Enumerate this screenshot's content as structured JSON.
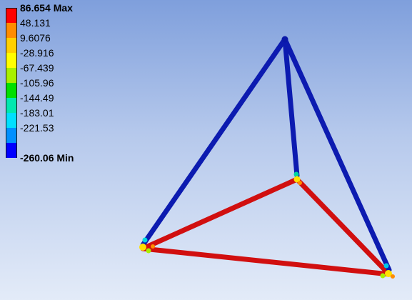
{
  "legend": {
    "max_label": "86.654 Max",
    "min_label": "-260.06 Min",
    "labels": [
      "48.131",
      "9.6076",
      "-28.916",
      "-67.439",
      "-105.96",
      "-144.49",
      "-183.01",
      "-221.53"
    ],
    "colors": [
      "#ff0000",
      "#ff8c00",
      "#ffd000",
      "#ffff00",
      "#a8f000",
      "#00e000",
      "#00e8b0",
      "#00e0ff",
      "#0090ff",
      "#0000ff"
    ]
  },
  "model": {
    "member_colors": {
      "upper_members": "#0c1bb0",
      "base_members": "#d10f0f"
    }
  }
}
